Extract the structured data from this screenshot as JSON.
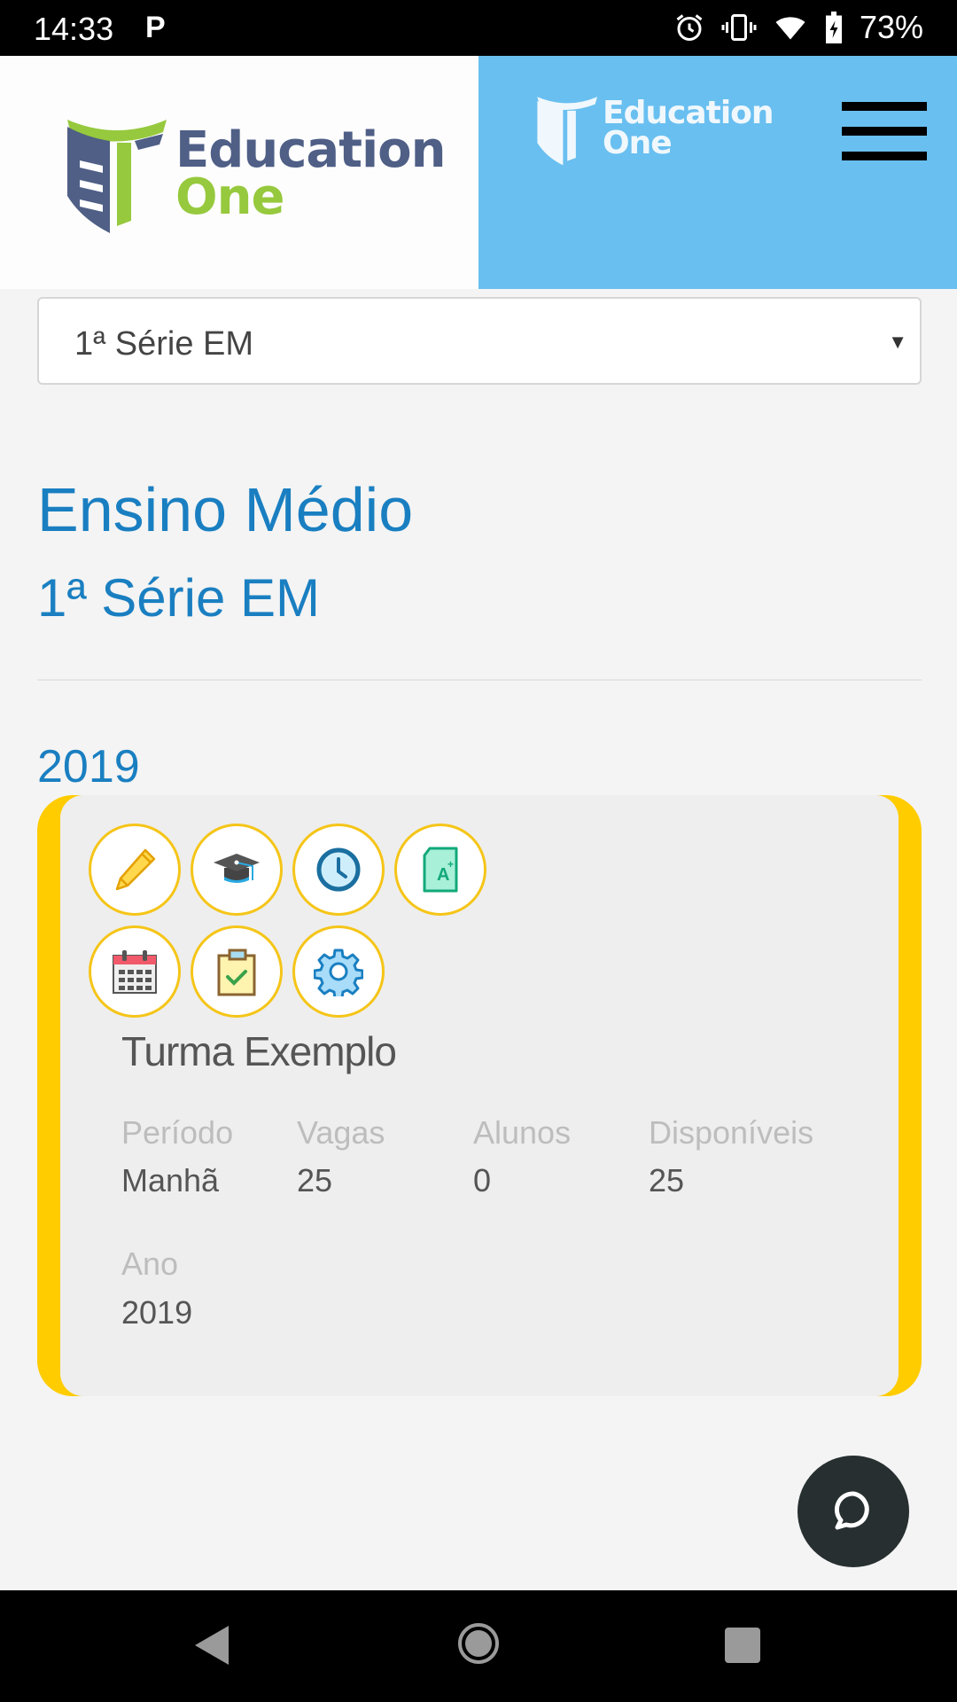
{
  "status_bar": {
    "time": "14:33",
    "notification_icon": "parking-icon",
    "icons": [
      "alarm-icon",
      "vibrate-icon",
      "wifi-icon",
      "battery-charging-icon"
    ],
    "battery": "73%"
  },
  "header": {
    "logo_line1": "Education",
    "logo_line2": "One",
    "menu_icon": "hamburger-icon"
  },
  "class_select": {
    "selected": "1ª Série EM"
  },
  "main": {
    "level_title": "Ensino Médio",
    "grade_title": "1ª Série EM",
    "year_heading": "2019"
  },
  "card": {
    "action_icons": [
      "pencil-icon",
      "graduation-cap-icon",
      "clock-icon",
      "grade-document-icon",
      "calendar-icon",
      "clipboard-check-icon",
      "gear-icon"
    ],
    "title": "Turma Exemplo",
    "fields": [
      {
        "label": "Período",
        "value": "Manhã"
      },
      {
        "label": "Vagas",
        "value": "25"
      },
      {
        "label": "Alunos",
        "value": "0"
      },
      {
        "label": "Disponíveis",
        "value": "25"
      },
      {
        "label": "Ano",
        "value": "2019"
      }
    ]
  },
  "colors": {
    "accent_blue": "#1a7fc1",
    "header_blue": "#69bff0",
    "card_border": "#ffcc00",
    "logo_navy": "#4f5f86",
    "logo_green": "#96c93d"
  }
}
